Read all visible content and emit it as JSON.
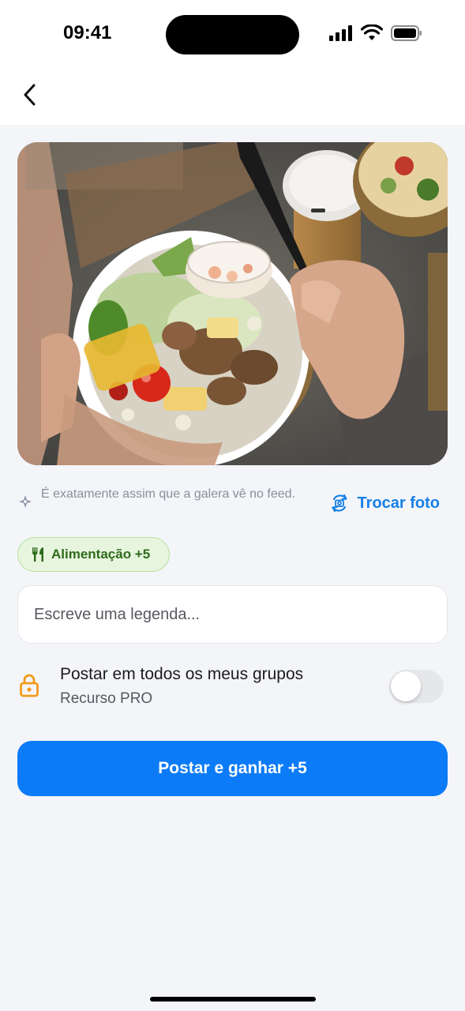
{
  "status_bar": {
    "time": "09:41"
  },
  "nav": {
    "back_icon": "chevron-left-icon"
  },
  "photo": {
    "subject": "salad-bowl-photo"
  },
  "hint": {
    "icon": "sparkle-icon",
    "text": "É exatamente assim que a galera vê no feed."
  },
  "swap_photo": {
    "icon": "camera-swap-icon",
    "label": "Trocar foto"
  },
  "category_chip": {
    "icon": "fork-knife-icon",
    "label": "Alimentação +5"
  },
  "caption": {
    "value": "",
    "placeholder": "Escreve uma legenda..."
  },
  "post_to_groups": {
    "icon": "lock-icon",
    "title": "Postar em todos os meus grupos",
    "subtitle": "Recurso PRO",
    "enabled": false
  },
  "primary_action": {
    "label": "Postar e ganhar +5"
  },
  "colors": {
    "accent": "#0c7bf8",
    "link": "#1680e8",
    "chip_bg": "#e7f5de",
    "chip_text": "#2f6b1c",
    "lock": "#f29b1c",
    "background": "#f4f5f9"
  }
}
